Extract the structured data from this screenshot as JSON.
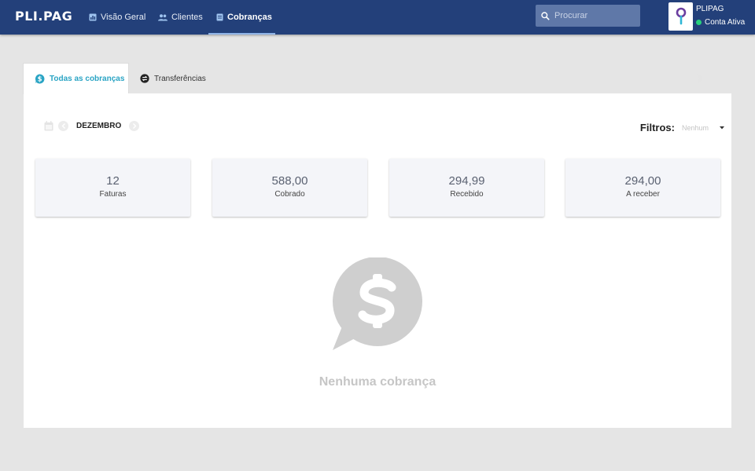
{
  "app": {
    "logo": "PLI.PAG"
  },
  "nav": {
    "items": [
      {
        "label": "Visão Geral",
        "icon": "dashboard-icon"
      },
      {
        "label": "Clientes",
        "icon": "people-icon"
      },
      {
        "label": "Cobranças",
        "icon": "invoice-icon",
        "active": true
      }
    ]
  },
  "search": {
    "placeholder": "Procurar"
  },
  "account": {
    "name": "PLIPAG",
    "status": "Conta Ativa",
    "status_color": "#28d17c"
  },
  "tabs": [
    {
      "label": "Todas as cobranças",
      "icon": "dollar-icon",
      "active": true
    },
    {
      "label": "Transferências",
      "icon": "transfer-icon",
      "active": false
    }
  ],
  "period": {
    "month": "DEZEMBRO"
  },
  "filters": {
    "label": "Filtros:",
    "value": "Nenhum"
  },
  "summary": [
    {
      "value": "12",
      "label": "Faturas"
    },
    {
      "value": "588,00",
      "label": "Cobrado"
    },
    {
      "value": "294,99",
      "label": "Recebido"
    },
    {
      "value": "294,00",
      "label": "A receber"
    }
  ],
  "empty_state": {
    "message": "Nenhuma cobrança",
    "icon": "dollar-chat-bubble-icon"
  },
  "colors": {
    "header": "#23407a",
    "accent": "#2aa4c4",
    "background": "#e5e5e5"
  }
}
